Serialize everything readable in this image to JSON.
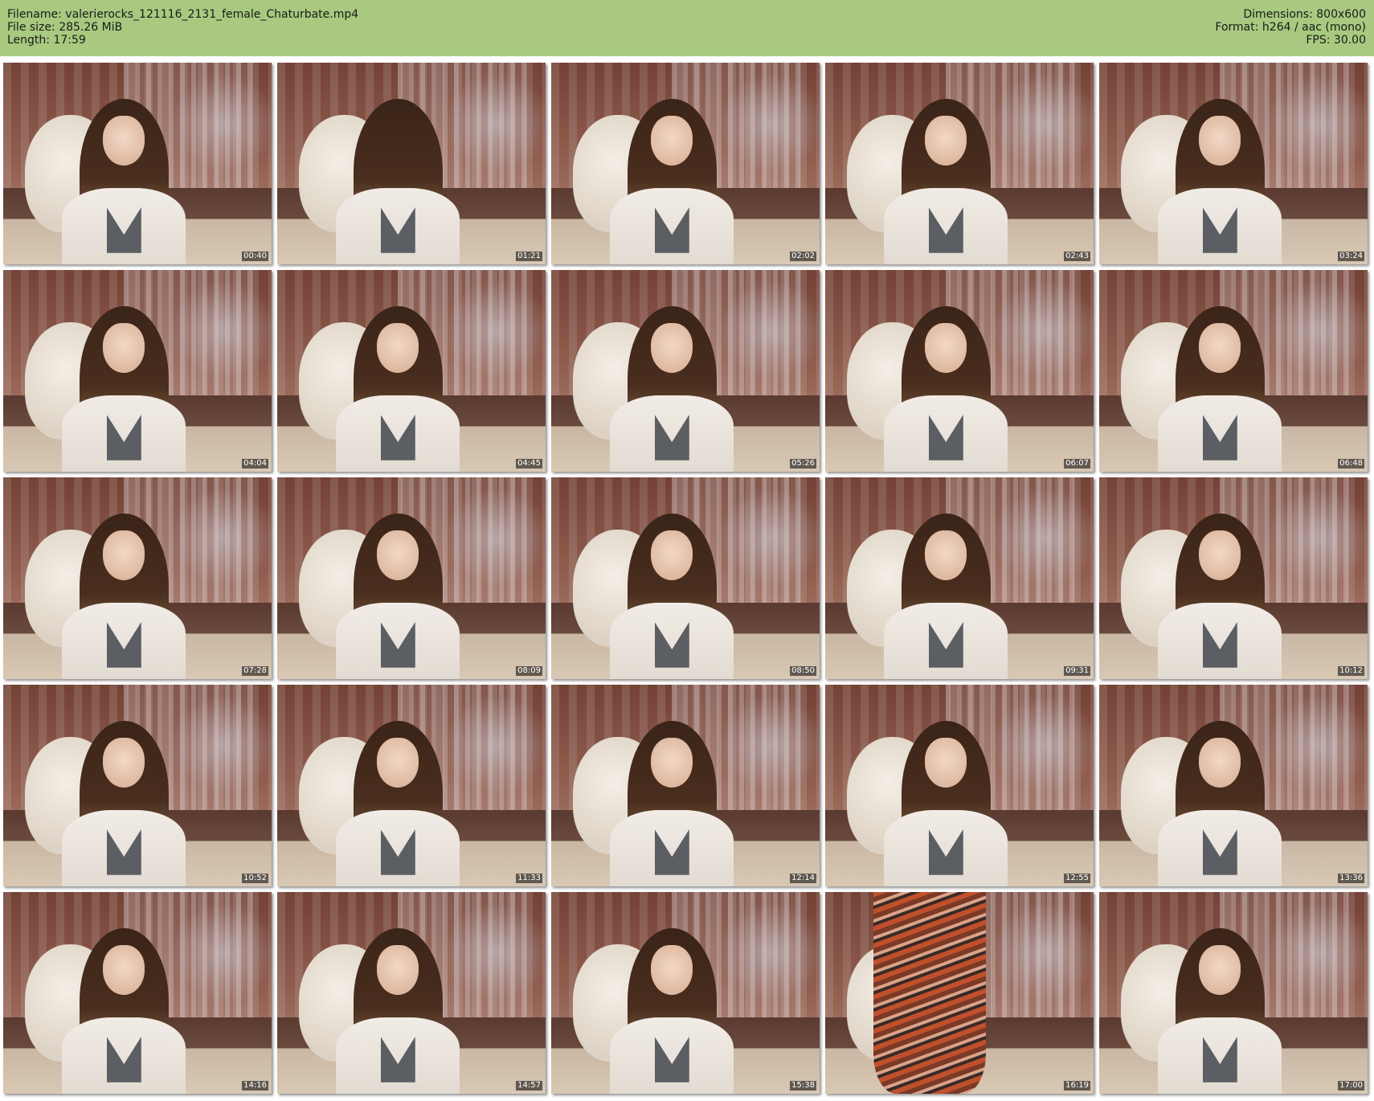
{
  "header": {
    "filename_line": "Filename: valerierocks_121116_2131_female_Chaturbate.mp4",
    "filesize_line": "File size: 285.26 MiB",
    "length_line": "Length: 17:59",
    "dimensions_line": "Dimensions: 800x600",
    "format_line": "Format: h264 / aac (mono)",
    "fps_line": "FPS: 30.00",
    "background_color": "#a8c97f"
  },
  "thumbnails": [
    {
      "timestamp": "00:40"
    },
    {
      "timestamp": "01:21"
    },
    {
      "timestamp": "02:02"
    },
    {
      "timestamp": "02:43"
    },
    {
      "timestamp": "03:24"
    },
    {
      "timestamp": "04:04"
    },
    {
      "timestamp": "04:45"
    },
    {
      "timestamp": "05:26"
    },
    {
      "timestamp": "06:07"
    },
    {
      "timestamp": "06:48"
    },
    {
      "timestamp": "07:28"
    },
    {
      "timestamp": "08:09"
    },
    {
      "timestamp": "08:50"
    },
    {
      "timestamp": "09:31"
    },
    {
      "timestamp": "10:12"
    },
    {
      "timestamp": "10:52"
    },
    {
      "timestamp": "11:33"
    },
    {
      "timestamp": "12:14"
    },
    {
      "timestamp": "12:55"
    },
    {
      "timestamp": "13:36"
    },
    {
      "timestamp": "14:16"
    },
    {
      "timestamp": "14:57"
    },
    {
      "timestamp": "15:38"
    },
    {
      "timestamp": "16:19"
    },
    {
      "timestamp": "17:00"
    }
  ]
}
